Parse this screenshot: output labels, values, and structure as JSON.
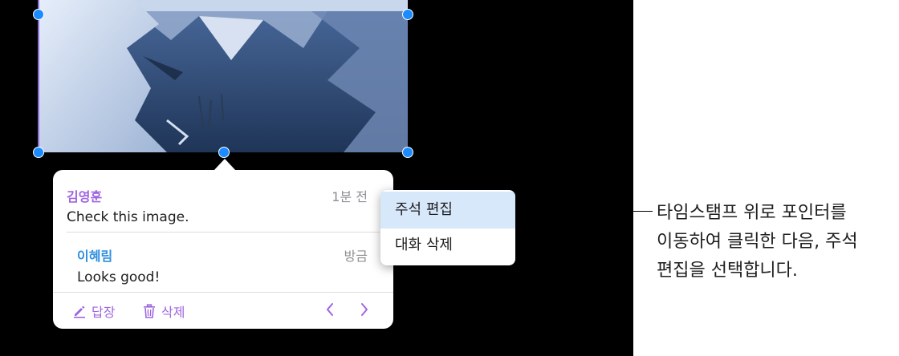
{
  "comment_thread": {
    "comments": [
      {
        "author": "김영훈",
        "time": "1분 전",
        "text": "Check this image."
      },
      {
        "author": "이혜림",
        "time": "방금",
        "text": "Looks good!"
      }
    ],
    "footer": {
      "reply_label": "답장",
      "delete_label": "삭제",
      "prev_icon": "chevron-left-icon",
      "next_icon": "chevron-right-icon"
    }
  },
  "context_menu": {
    "items": [
      {
        "label": "주석 편집",
        "highlighted": true
      },
      {
        "label": "대화 삭제",
        "highlighted": false
      }
    ]
  },
  "callout": {
    "lines": [
      "타임스탬프 위로 포인터를",
      "이동하여 클릭한 다음, 주석",
      "편집을 선택합니다."
    ]
  },
  "colors": {
    "accent_purple": "#a066e0",
    "reply_blue": "#2e8fe0",
    "selection_handle": "#1a8cff",
    "menu_highlight": "#d7e8fb",
    "canvas_background": "#000000"
  }
}
